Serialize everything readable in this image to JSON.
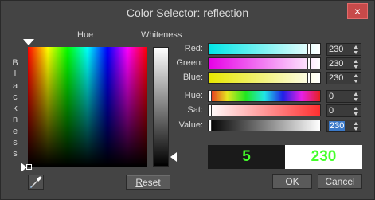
{
  "title": "Color Selector: reflection",
  "labels": {
    "hue": "Hue",
    "whiteness": "Whiteness",
    "blackness": "Blackness"
  },
  "close": "×",
  "sliders": [
    {
      "label": "Red:",
      "value": "230",
      "gradient": "linear-gradient(to right,#00e6e6,#ffffff)",
      "thumb": 0.9
    },
    {
      "label": "Green:",
      "value": "230",
      "gradient": "linear-gradient(to right,#e600e6,#ffffff)",
      "thumb": 0.9
    },
    {
      "label": "Blue:",
      "value": "230",
      "gradient": "linear-gradient(to right,#e6e600,#ffffff)",
      "thumb": 0.9
    },
    {
      "label": "Hue:",
      "value": "0",
      "gradient": "linear-gradient(to right,#e62020,#e6e620,#20e620,#20e6e6,#2020e6,#e620e6,#e62020)",
      "thumb": 0.0
    },
    {
      "label": "Sat:",
      "value": "0",
      "gradient": "linear-gradient(to right,#ffffff,#ff3030)",
      "thumb": 0.0
    },
    {
      "label": "Value:",
      "value": "230",
      "gradient": "linear-gradient(to right,#000000,#ffffff)",
      "thumb": 0.0,
      "selected": true
    }
  ],
  "swatches": {
    "old": "5",
    "new": "230",
    "old_bg": "#1a1a1a",
    "new_bg": "#ffffff"
  },
  "buttons": {
    "reset": "Reset",
    "ok": "OK",
    "cancel": "Cancel"
  },
  "icons": {
    "eyedropper": "eyedropper-icon"
  }
}
